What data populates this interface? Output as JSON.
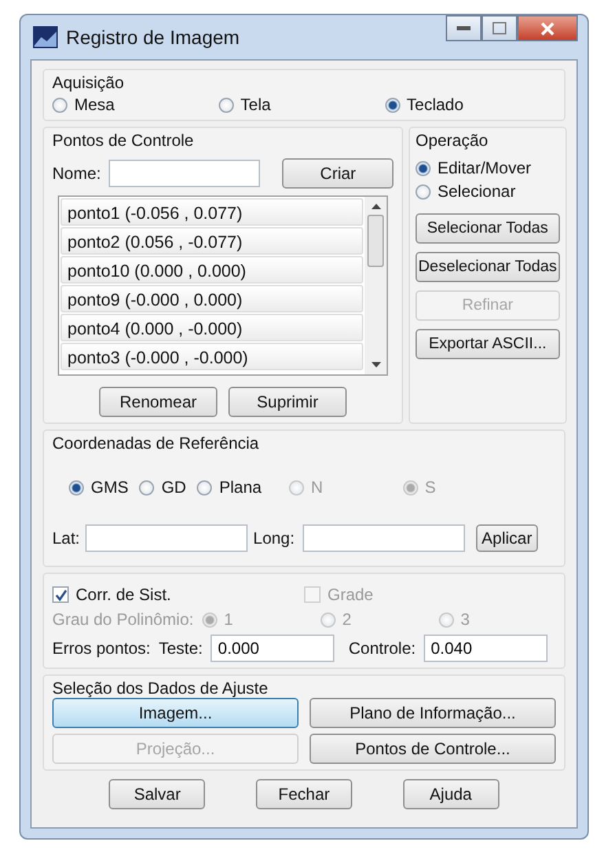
{
  "window": {
    "title": "Registro de Imagem"
  },
  "acquisition": {
    "title": "Aquisição",
    "options": [
      {
        "label": "Mesa",
        "selected": false
      },
      {
        "label": "Tela",
        "selected": false
      },
      {
        "label": "Teclado",
        "selected": true
      }
    ]
  },
  "control_points": {
    "title": "Pontos de Controle",
    "name_label": "Nome:",
    "create_button": "Criar",
    "points": [
      "ponto1 (-0.056 , 0.077)",
      "ponto2 (0.056 , -0.077)",
      "ponto10 (0.000 , 0.000)",
      "ponto9 (-0.000 , 0.000)",
      "ponto4 (0.000 , -0.000)",
      "ponto3 (-0.000 , -0.000)"
    ],
    "buttons": [
      "Renomear",
      "Suprimir"
    ]
  },
  "operation": {
    "title": "Operação",
    "options": [
      {
        "label": "Editar/Mover",
        "selected": true
      },
      {
        "label": "Selecionar",
        "selected": false
      }
    ],
    "buttons": [
      {
        "label": "Selecionar Todas",
        "disabled": false
      },
      {
        "label": "Deselecionar Todas",
        "disabled": false
      },
      {
        "label": "Refinar",
        "disabled": true
      },
      {
        "label": "Exportar ASCII...",
        "disabled": false
      }
    ]
  },
  "reference": {
    "title": "Coordenadas de Referência",
    "options": [
      {
        "label": "GMS",
        "selected": true,
        "disabled": false
      },
      {
        "label": "GD",
        "selected": false,
        "disabled": false
      },
      {
        "label": "Plana",
        "selected": false,
        "disabled": false
      },
      {
        "label": "N",
        "selected": false,
        "disabled": true
      },
      {
        "label": "S",
        "selected": true,
        "disabled": true
      }
    ],
    "lat_label": "Lat:",
    "long_label": "Long:",
    "apply_button": "Aplicar"
  },
  "correction": {
    "checkboxes": [
      {
        "label": "Corr. de Sist.",
        "checked": true,
        "disabled": false
      },
      {
        "label": "Grade",
        "checked": false,
        "disabled": true
      }
    ],
    "degree_label": "Grau do Polinômio:",
    "degree_options": [
      {
        "label": "1",
        "selected": true,
        "disabled": true
      },
      {
        "label": "2",
        "selected": false,
        "disabled": true
      },
      {
        "label": "3",
        "selected": false,
        "disabled": true
      }
    ],
    "errors_label": "Erros pontos:",
    "test_label": "Teste:",
    "test_value": "0.000",
    "control_label": "Controle:",
    "control_value": "0.040"
  },
  "adjust": {
    "title": "Seleção dos Dados de Ajuste",
    "buttons": [
      {
        "label": "Imagem...",
        "disabled": false,
        "focused": true
      },
      {
        "label": "Plano de Informação...",
        "disabled": false,
        "focused": false
      },
      {
        "label": "Projeção...",
        "disabled": true,
        "focused": false
      },
      {
        "label": "Pontos de Controle...",
        "disabled": false,
        "focused": false
      }
    ]
  },
  "footer": {
    "buttons": [
      "Salvar",
      "Fechar",
      "Ajuda"
    ]
  }
}
